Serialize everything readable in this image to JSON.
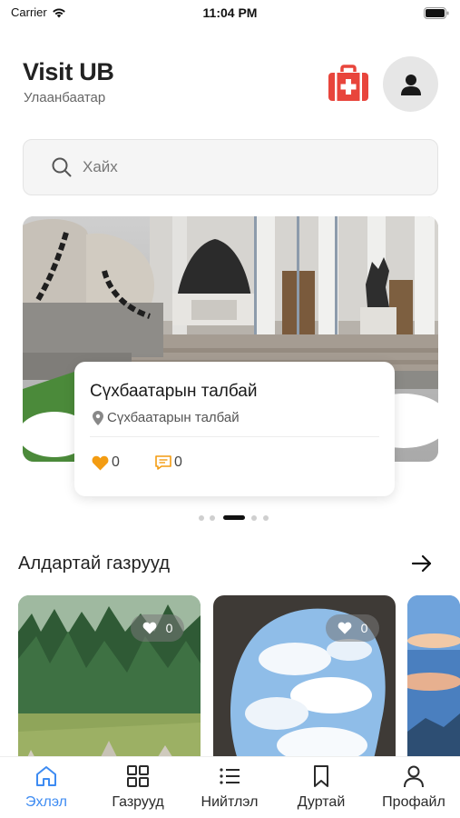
{
  "status_bar": {
    "carrier": "Carrier",
    "time": "11:04 PM"
  },
  "header": {
    "title": "Visit UB",
    "subtitle": "Улаанбаатар"
  },
  "search": {
    "placeholder": "Хайх"
  },
  "hero": {
    "title": "Сүхбаатарын талбай",
    "location": "Сүхбаатарын талбай",
    "likes": "0",
    "comments": "0",
    "pager": {
      "count": 5,
      "active_index": 2
    }
  },
  "popular": {
    "title": "Алдартай газрууд",
    "cards": [
      {
        "likes": "0"
      },
      {
        "likes": "0"
      }
    ]
  },
  "tabs": [
    {
      "label": "Эхлэл",
      "icon": "home-icon",
      "active": true
    },
    {
      "label": "Газрууд",
      "icon": "grid-icon",
      "active": false
    },
    {
      "label": "Нийтлэл",
      "icon": "list-icon",
      "active": false
    },
    {
      "label": "Дуртай",
      "icon": "bookmark-icon",
      "active": false
    },
    {
      "label": "Профайл",
      "icon": "person-icon",
      "active": false
    }
  ],
  "colors": {
    "accent": "#3d8bf2",
    "first_aid": "#e8453c",
    "like": "#f39c12"
  }
}
